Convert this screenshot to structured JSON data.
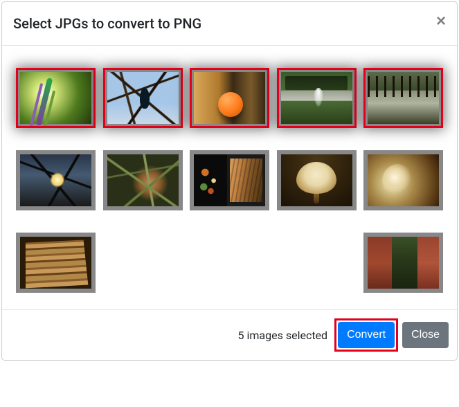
{
  "header": {
    "title": "Select JPGs to convert to PNG",
    "close_glyph": "×"
  },
  "thumbnails": [
    {
      "name": "thumb-purple-flower",
      "selected": true
    },
    {
      "name": "thumb-bird-branches",
      "selected": true
    },
    {
      "name": "thumb-orange-fruit",
      "selected": true
    },
    {
      "name": "thumb-fountain-pond",
      "selected": true
    },
    {
      "name": "thumb-park-trees",
      "selected": true
    },
    {
      "name": "thumb-sun-branches",
      "selected": false
    },
    {
      "name": "thumb-grass-closeup",
      "selected": false
    },
    {
      "name": "thumb-food-plate",
      "selected": false
    },
    {
      "name": "thumb-pendant-lamp",
      "selected": false
    },
    {
      "name": "thumb-bannister-knob",
      "selected": false
    },
    {
      "name": "thumb-wood-stack",
      "selected": false
    },
    {
      "name": "thumb-lizard-post",
      "selected": false
    }
  ],
  "footer": {
    "status": "5 images selected",
    "convert_label": "Convert",
    "close_label": "Close"
  }
}
